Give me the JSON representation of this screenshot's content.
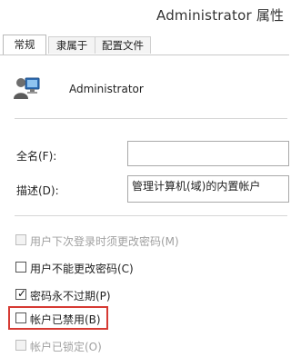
{
  "window": {
    "title": "Administrator 属性"
  },
  "tabs": [
    {
      "label": "常规"
    },
    {
      "label": "隶属于"
    },
    {
      "label": "配置文件"
    }
  ],
  "user": {
    "name": "Administrator",
    "icon": "user-monitor-icon"
  },
  "fields": {
    "fullname_label": "全名(F):",
    "fullname_value": "",
    "description_label": "描述(D):",
    "description_value": "管理计算机(域)的内置帐户"
  },
  "checkboxes": [
    {
      "label": "用户下次登录时须更改密码(M)",
      "checked": false,
      "enabled": false
    },
    {
      "label": "用户不能更改密码(C)",
      "checked": false,
      "enabled": true
    },
    {
      "label": "密码永不过期(P)",
      "checked": true,
      "enabled": true
    },
    {
      "label": "帐户已禁用(B)",
      "checked": false,
      "enabled": true,
      "highlighted": true
    },
    {
      "label": "帐户已锁定(O)",
      "checked": false,
      "enabled": false
    }
  ],
  "colors": {
    "highlight": "#d63a33"
  }
}
